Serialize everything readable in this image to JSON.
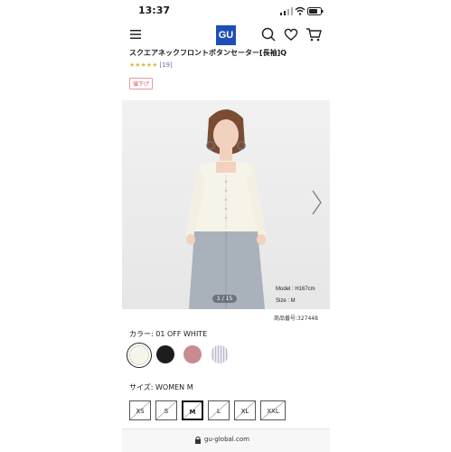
{
  "status": {
    "time": "13:37"
  },
  "header": {
    "logo": "GU"
  },
  "product": {
    "title": "スクエアネックフロントボタンセーター[長袖]Q",
    "stars": "★★★★★",
    "review_count": "[19]",
    "badge": "値下げ",
    "product_number": "商品番号:327448"
  },
  "gallery": {
    "model_height": "Model : H167cm",
    "model_size": "Size : M",
    "pager": "1 / 15"
  },
  "color": {
    "label": "カラー:",
    "selected": "01 OFF WHITE",
    "swatches": [
      {
        "name": "off-white",
        "hex": "#f7f4ea"
      },
      {
        "name": "black",
        "hex": "#1d1d1d"
      },
      {
        "name": "pink",
        "hex": "#c98a92"
      },
      {
        "name": "stripe",
        "hex": "#c9c9d8"
      }
    ]
  },
  "size": {
    "label": "サイズ:",
    "selected": "WOMEN M",
    "options": [
      "XS",
      "S",
      "M",
      "L",
      "XL",
      "XXL"
    ]
  },
  "browser": {
    "url": "gu-global.com"
  }
}
